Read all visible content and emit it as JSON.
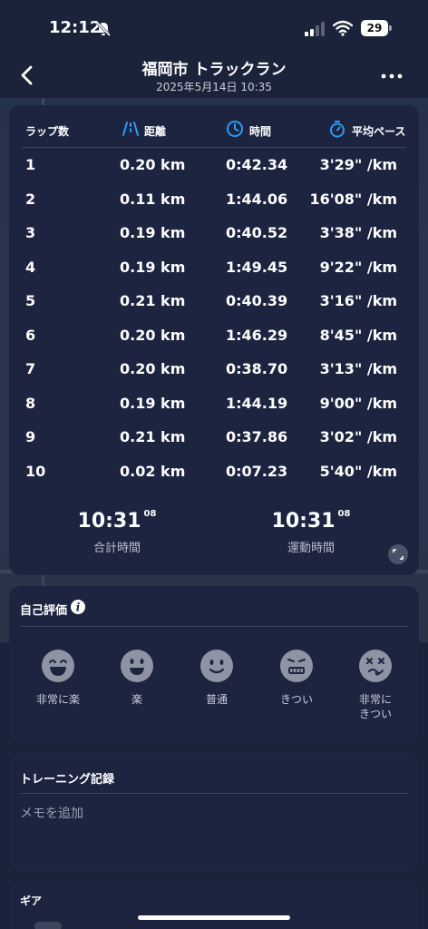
{
  "status_bar": {
    "time": "12:12",
    "battery": "29"
  },
  "header": {
    "title": "福岡市 トラックラン",
    "subtitle": "2025年5月14日 10:35"
  },
  "laps": {
    "columns": [
      "ラップ数",
      "距離",
      "時間",
      "平均ペース"
    ],
    "rows": [
      {
        "lap": "1",
        "distance": "0.20 km",
        "time": "0:42.34",
        "pace": "3'29\" /km"
      },
      {
        "lap": "2",
        "distance": "0.11 km",
        "time": "1:44.06",
        "pace": "16'08\" /km"
      },
      {
        "lap": "3",
        "distance": "0.19 km",
        "time": "0:40.52",
        "pace": "3'38\" /km"
      },
      {
        "lap": "4",
        "distance": "0.19 km",
        "time": "1:49.45",
        "pace": "9'22\" /km"
      },
      {
        "lap": "5",
        "distance": "0.21 km",
        "time": "0:40.39",
        "pace": "3'16\" /km"
      },
      {
        "lap": "6",
        "distance": "0.20 km",
        "time": "1:46.29",
        "pace": "8'45\" /km"
      },
      {
        "lap": "7",
        "distance": "0.20 km",
        "time": "0:38.70",
        "pace": "3'13\" /km"
      },
      {
        "lap": "8",
        "distance": "0.19 km",
        "time": "1:44.19",
        "pace": "9'00\" /km"
      },
      {
        "lap": "9",
        "distance": "0.21 km",
        "time": "0:37.86",
        "pace": "3'02\" /km"
      },
      {
        "lap": "10",
        "distance": "0.02 km",
        "time": "0:07.23",
        "pace": "5'40\" /km"
      }
    ],
    "total_time": {
      "main": "10:31",
      "sub": "08",
      "label": "合計時間"
    },
    "moving_time": {
      "main": "10:31",
      "sub": "08",
      "label": "運動時間"
    }
  },
  "self_evaluation": {
    "title": "自己評価",
    "options": [
      "非常に楽",
      "楽",
      "普通",
      "きつい",
      "非常に\nきつい"
    ]
  },
  "training_record": {
    "title": "トレーニング記録",
    "placeholder": "メモを追加"
  },
  "gear": {
    "title": "ギア"
  },
  "colors": {
    "background": "#1a2339",
    "card": "#1c2440",
    "accent": "#2a9df4",
    "face": "#8e94a3"
  }
}
